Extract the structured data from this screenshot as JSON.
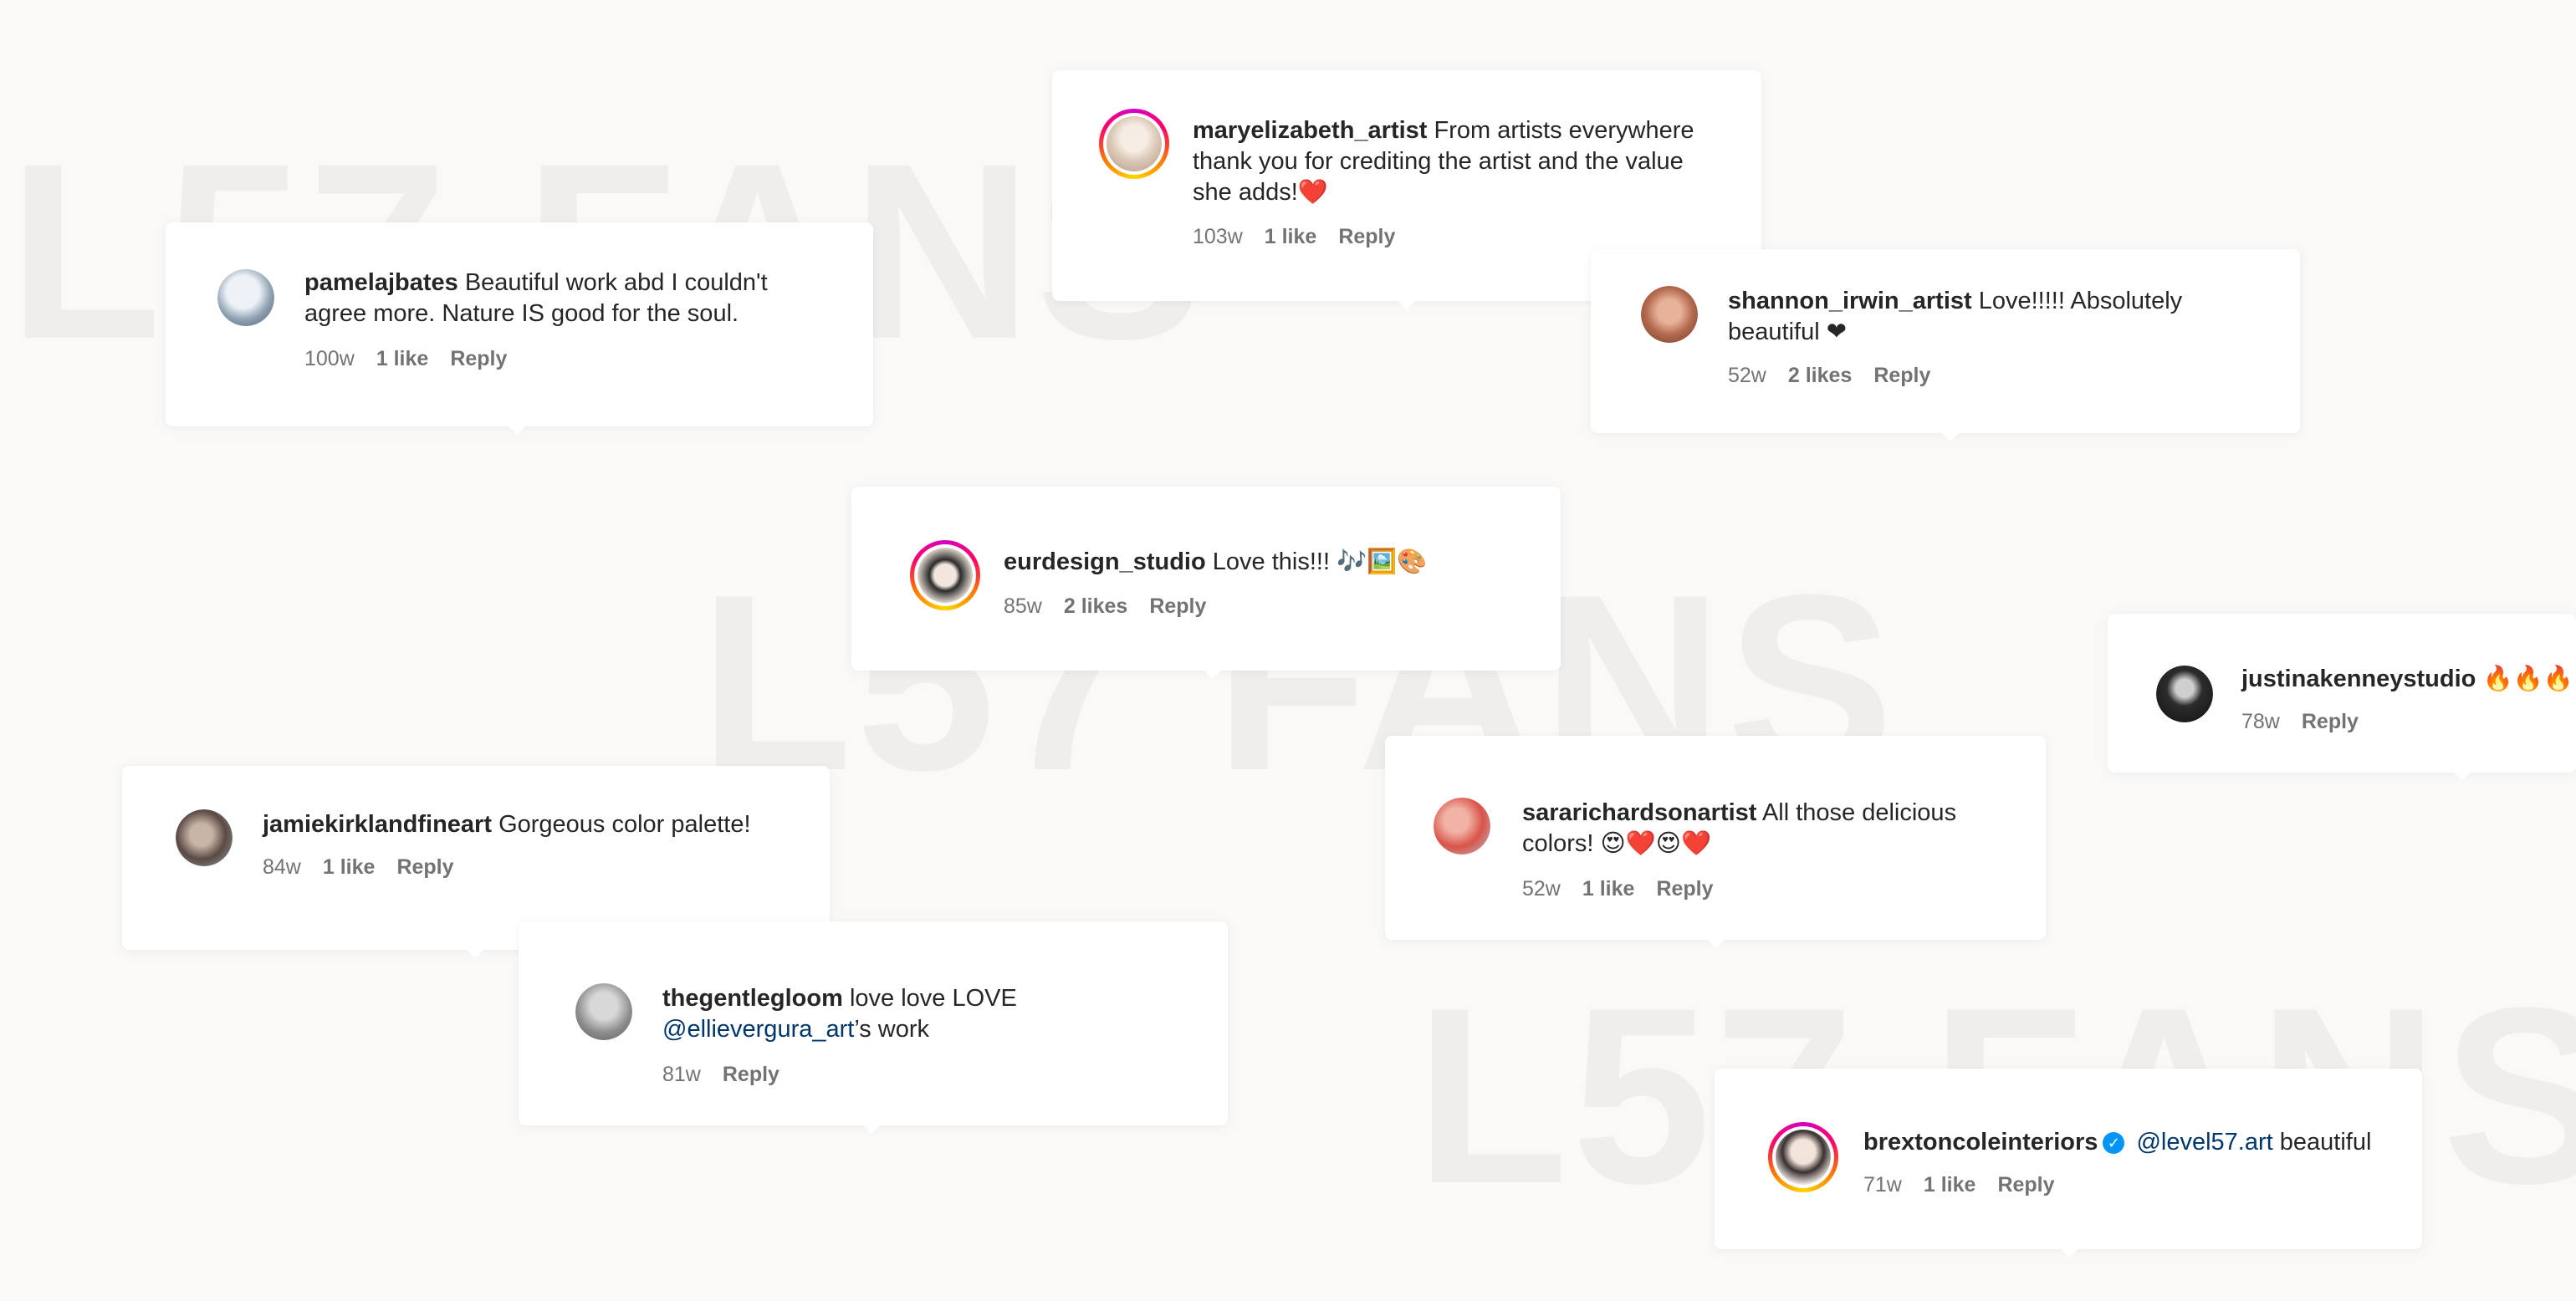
{
  "background_text": [
    "L57 FANS",
    "L57 FANS",
    "L57 FANS"
  ],
  "colors": {
    "background": "#faf9f7",
    "text": "#262626",
    "meta": "#737373",
    "mention": "#00376b",
    "verified": "#0095f6"
  },
  "comments": [
    {
      "username": "pamelajbates",
      "text": "Beautiful work abd I couldn't agree more. Nature IS good for the soul.",
      "age": "100w",
      "likes": "1 like",
      "reply": "Reply"
    },
    {
      "username": "maryelizabeth_artist",
      "text": "From artists everywhere thank you for crediting the artist and the value she adds!❤️",
      "age": "103w",
      "likes": "1 like",
      "reply": "Reply"
    },
    {
      "username": "shannon_irwin_artist",
      "text": "Love!!!!! Absolutely beautiful ❤",
      "age": "52w",
      "likes": "2 likes",
      "reply": "Reply"
    },
    {
      "username": "eurdesign_studio",
      "text": "Love this!!! 🎶🖼️🎨",
      "age": "85w",
      "likes": "2 likes",
      "reply": "Reply"
    },
    {
      "username": "justinakenneystudio",
      "text": "🔥🔥🔥",
      "age": "78w",
      "reply": "Reply"
    },
    {
      "username": "jamiekirklandfineart",
      "text": "Gorgeous color palette!",
      "age": "84w",
      "likes": "1 like",
      "reply": "Reply"
    },
    {
      "username": "sararichardsonartist",
      "text": "All those delicious colors! 😍❤️😍❤️",
      "age": "52w",
      "likes": "1 like",
      "reply": "Reply"
    },
    {
      "username": "thegentlegloom",
      "text_before": "love love LOVE",
      "mention": "@ellievergura_art",
      "text_after": "’s work",
      "age": "81w",
      "reply": "Reply"
    },
    {
      "username": "brextoncoleinteriors",
      "verified_icon": "✓",
      "mention": "@level57.art",
      "text_after": "beautiful",
      "age": "71w",
      "likes": "1 like",
      "reply": "Reply"
    }
  ]
}
